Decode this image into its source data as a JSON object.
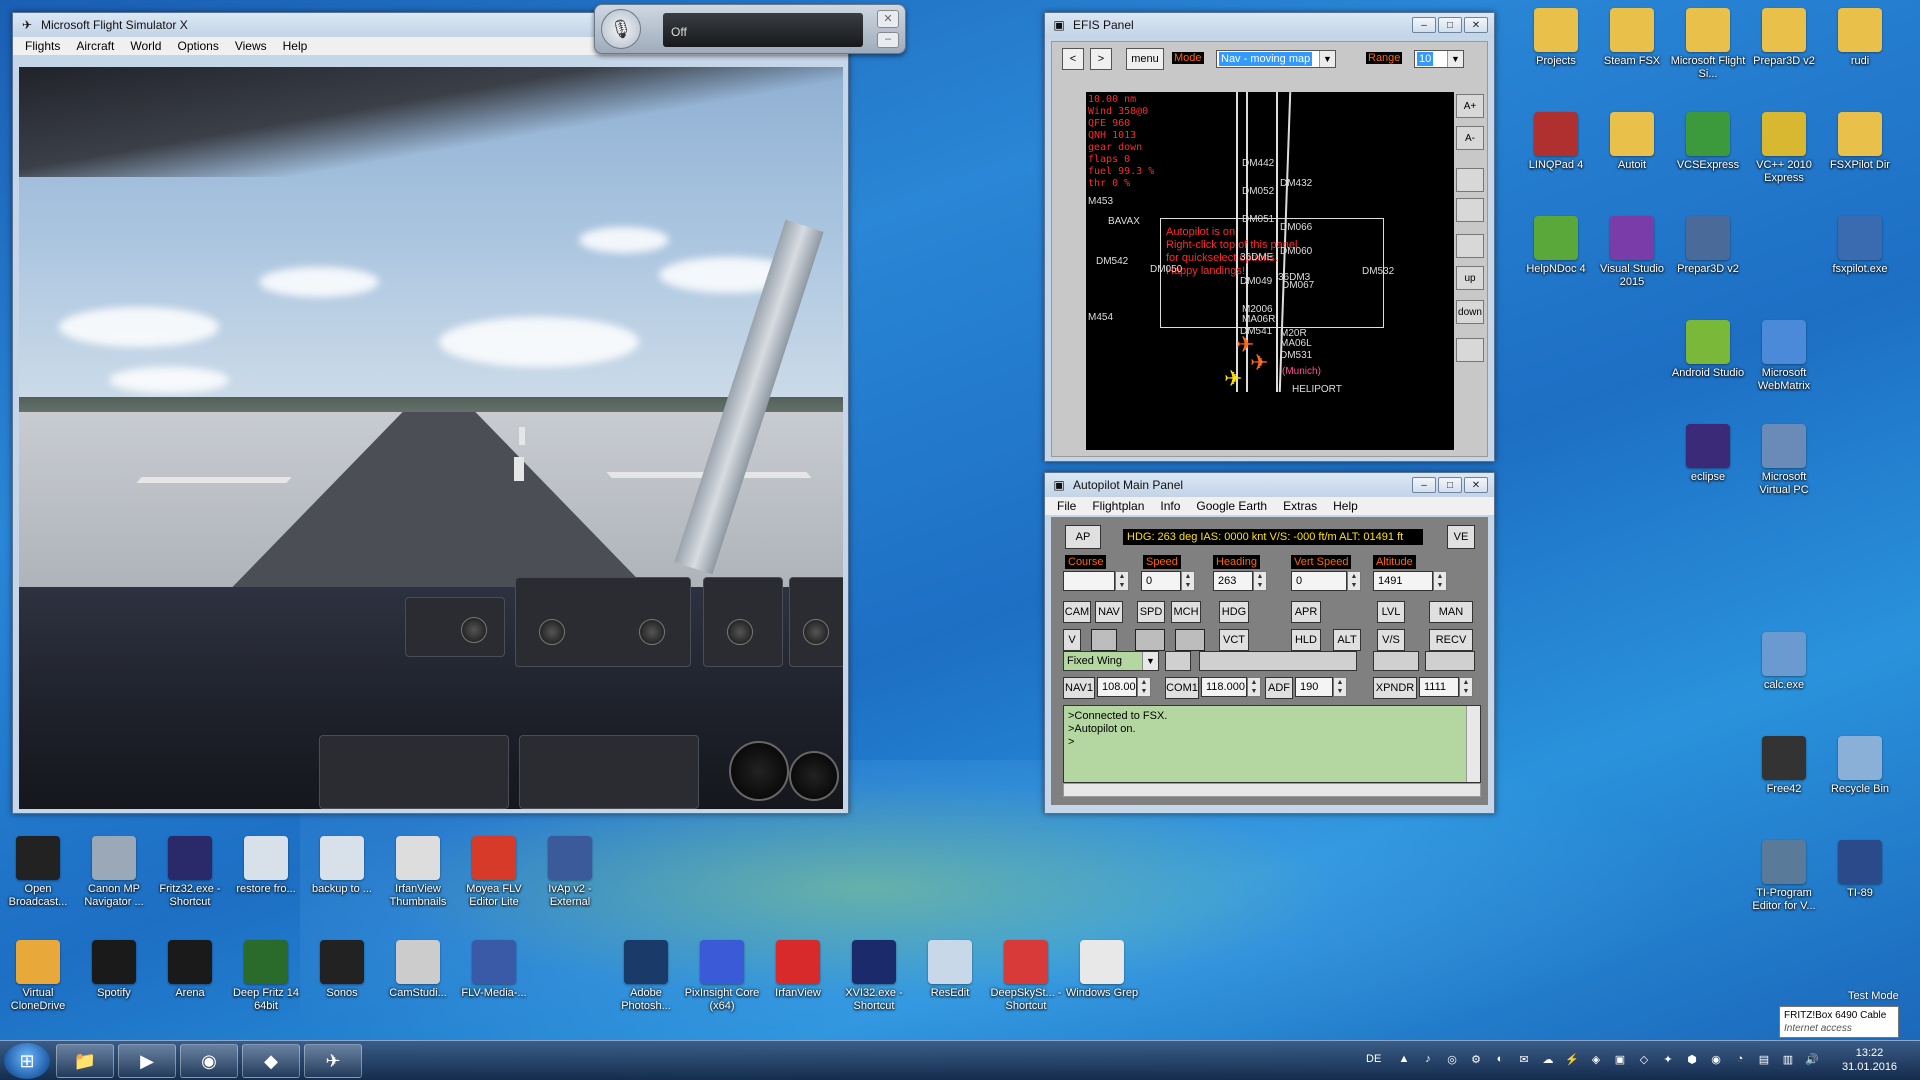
{
  "fsx": {
    "title": "Microsoft Flight Simulator X",
    "menu": [
      "Flights",
      "Aircraft",
      "World",
      "Options",
      "Views",
      "Help"
    ]
  },
  "voice": {
    "status": "Off"
  },
  "efis": {
    "title": "EFIS Panel",
    "btn_prev": "<",
    "btn_next": ">",
    "btn_menu": "menu",
    "mode_label": "Mode",
    "mode_value": "Nav - moving map",
    "range_label": "Range",
    "range_value": "10",
    "side_buttons": [
      "A+",
      "A-",
      "up",
      "down"
    ],
    "info_lines": [
      "10.00 nm",
      "Wind 358@0",
      "QFE 960",
      "QNH 1013",
      "gear down",
      "flaps 0",
      "fuel 99.3 %",
      "thr  0 %"
    ],
    "autopilot_msg": [
      "Autopilot is on",
      "Right-click top of this panel",
      "for quickselect options.",
      "Happy landings!"
    ],
    "waypoints": [
      "DM442",
      "DM432",
      "DM052",
      "M453",
      "BAVAX",
      "DM051",
      "DM066",
      "DM542",
      "DM050",
      "36DME",
      "DM060",
      "DM532",
      "DM049",
      "36DM3",
      "DM067",
      "M454",
      "M2006",
      "MA06R",
      "DM541",
      "M20R",
      "MA06L",
      "DM531",
      "(Munich)",
      "HELIPORT"
    ]
  },
  "autopilot": {
    "title": "Autopilot Main Panel",
    "menu": [
      "File",
      "Flightplan",
      "Info",
      "Google Earth",
      "Extras",
      "Help"
    ],
    "ap_button": "AP",
    "status_line": "HDG: 263 deg IAS: 0000 knt V/S: -000 ft/m ALT: 01491 ft",
    "ve_button": "VE",
    "labels": {
      "course": "Course",
      "speed": "Speed",
      "heading": "Heading",
      "vert_speed": "Vert Speed",
      "altitude": "Altitude"
    },
    "values": {
      "course": "",
      "speed": "0",
      "heading": "263",
      "vert_speed": "0",
      "altitude": "1491"
    },
    "row1": [
      "CAM",
      "NAV",
      "SPD",
      "MCH",
      "HDG",
      "APR",
      "LVL",
      "MAN"
    ],
    "row2": [
      "V",
      "VCT",
      "HLD",
      "ALT",
      "V/S",
      "RECV"
    ],
    "aircraft_type": "Fixed Wing",
    "radios": {
      "nav1_label": "NAV1",
      "nav1_value": "108.00",
      "com1_label": "COM1",
      "com1_value": "118.000",
      "adf_label": "ADF",
      "adf_value": "190",
      "xpndr_label": "XPNDR",
      "xpndr_value": "1111"
    },
    "log": [
      ">Connected to FSX.",
      ">Autopilot on.",
      ">"
    ]
  },
  "desktop": {
    "right_icons": [
      {
        "label": "Projects",
        "color": "#e8c04a"
      },
      {
        "label": "Steam FSX",
        "color": "#e8c04a"
      },
      {
        "label": "Microsoft Flight Si...",
        "color": "#e8c04a"
      },
      {
        "label": "Prepar3D v2",
        "color": "#e8c04a"
      },
      {
        "label": "rudi",
        "color": "#e8c04a"
      },
      {
        "label": "LINQPad 4",
        "color": "#b03030"
      },
      {
        "label": "Autoit",
        "color": "#e8c04a"
      },
      {
        "label": "VCSExpress",
        "color": "#3c9a3c"
      },
      {
        "label": "VC++ 2010 Express",
        "color": "#d8b830"
      },
      {
        "label": "FSXPilot Dir",
        "color": "#e8c04a"
      },
      {
        "label": "HelpNDoc 4",
        "color": "#5aa83a"
      },
      {
        "label": "Visual Studio 2015",
        "color": "#7a3ca8"
      },
      {
        "label": "Prepar3D v2",
        "color": "#4a6a9a"
      },
      {
        "label": "fsxpilot.exe",
        "color": "#3a6ab0"
      },
      {
        "label": "Android Studio",
        "color": "#7ab83a"
      },
      {
        "label": "Microsoft WebMatrix",
        "color": "#4a8ad8"
      },
      {
        "label": "eclipse",
        "color": "#3a2a78"
      },
      {
        "label": "Microsoft Virtual PC",
        "color": "#6a8ab8"
      },
      {
        "label": "calc.exe",
        "color": "#6a9ad0"
      },
      {
        "label": "Free42",
        "color": "#333333"
      },
      {
        "label": "Recycle Bin",
        "color": "#8ab0d8"
      },
      {
        "label": "TI-Program Editor for V...",
        "color": "#5a7a9a"
      },
      {
        "label": "TI-89",
        "color": "#2a4a8a"
      }
    ],
    "bottom_row1": [
      {
        "label": "Open Broadcast...",
        "color": "#222222"
      },
      {
        "label": "Canon MP Navigator ...",
        "color": "#9aa8b8"
      },
      {
        "label": "Fritz32.exe - Shortcut",
        "color": "#2a2a6a"
      },
      {
        "label": "restore fro...",
        "color": "#d8e0ea"
      },
      {
        "label": "backup to ...",
        "color": "#d8e0ea"
      },
      {
        "label": "IrfanView Thumbnails",
        "color": "#dddddd"
      },
      {
        "label": "Moyea FLV Editor Lite",
        "color": "#d83a2a"
      },
      {
        "label": "IvAp v2 - External",
        "color": "#3a5a9a"
      }
    ],
    "bottom_row2": [
      {
        "label": "Virtual CloneDrive",
        "color": "#e8a83a"
      },
      {
        "label": "Spotify",
        "color": "#1a1a1a"
      },
      {
        "label": "Arena",
        "color": "#1a1a1a"
      },
      {
        "label": "Deep Fritz 14 64bit",
        "color": "#2a6a2a"
      },
      {
        "label": "Sonos",
        "color": "#222222"
      },
      {
        "label": "CamStudi...",
        "color": "#cccccc"
      },
      {
        "label": "FLV-Media-...",
        "color": "#3a5aa8"
      },
      {
        "label": "Adobe Photosh...",
        "color": "#1a3a6a"
      },
      {
        "label": "PixInsight Core (x64)",
        "color": "#3a5ad8"
      },
      {
        "label": "IrfanView",
        "color": "#d82a2a"
      },
      {
        "label": "XVI32.exe - Shortcut",
        "color": "#1a2a6a"
      },
      {
        "label": "ResEdit",
        "color": "#c8d8e8"
      },
      {
        "label": "DeepSkySt... - Shortcut",
        "color": "#d83a3a"
      },
      {
        "label": "Windows Grep",
        "color": "#e8e8e8"
      }
    ],
    "icon_glyphs": {
      "Ps": "Ps",
      "14": "14",
      "SONOS": "SONOS",
      "FSX": "FSX",
      "P3D": "P3D",
      "c#": "c#"
    },
    "test_mode": "Test Mode"
  },
  "taskbar": {
    "lang": "DE",
    "time": "13:22",
    "date": "31.01.2016"
  },
  "tooltip": {
    "line1": "FRITZ!Box 6490 Cable",
    "line2": "Internet access"
  }
}
